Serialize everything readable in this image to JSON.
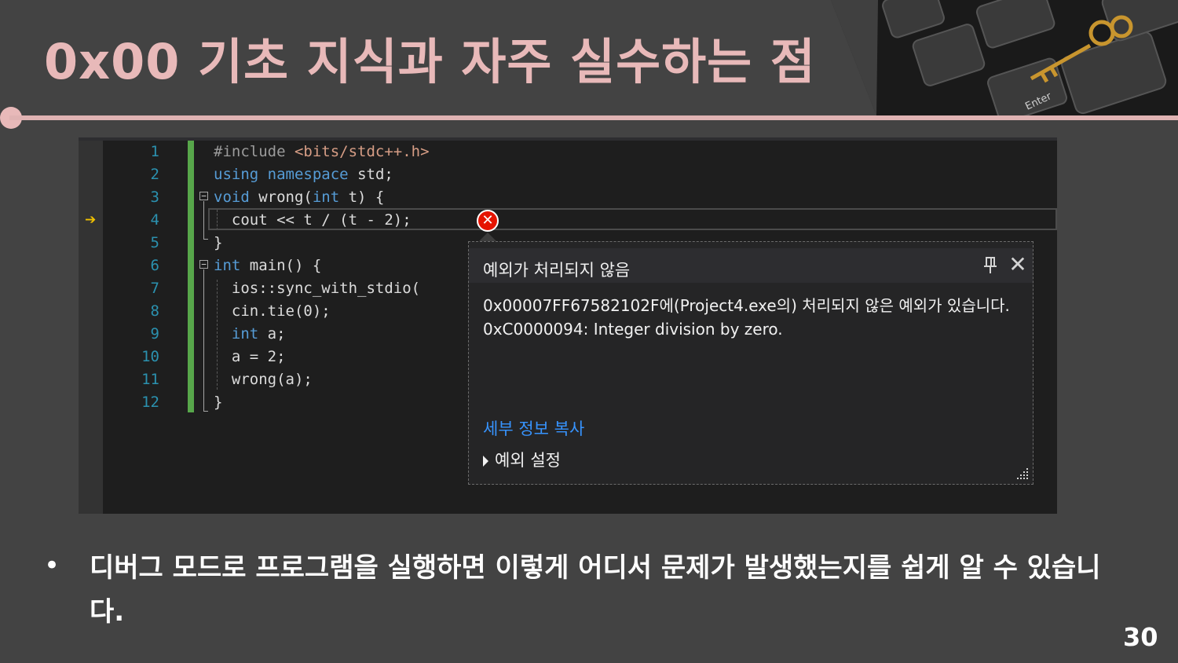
{
  "slide": {
    "title": "0x00  기초 지식과 자주 실수하는 점",
    "bullet": "디버그 모드로 프로그램을 실행하면 이렇게 어디서 문제가 발생했는지를 쉽게 알 수 있습니다.",
    "page_number": "30"
  },
  "editor": {
    "line_numbers": [
      "1",
      "2",
      "3",
      "4",
      "5",
      "6",
      "7",
      "8",
      "9",
      "10",
      "11",
      "12"
    ],
    "code": {
      "l1_pre": "#include",
      "l1_str": "<bits/stdc++.h>",
      "l2_kw1": "using",
      "l2_kw2": "namespace",
      "l2_rest": "std;",
      "l3_kw": "void",
      "l3_mid": " wrong(",
      "l3_kw2": "int",
      "l3_end": " t) {",
      "l4": "  cout << t / (t - 2);",
      "l5": "}",
      "l6_kw": "int",
      "l6_rest": " main() {",
      "l7": "  ios::sync_with_stdio(",
      "l8": "  cin.tie(0);",
      "l9_kw": "int",
      "l9_rest": " a;",
      "l10": "  a = 2;",
      "l11": "  wrong(a);",
      "l12": "}"
    }
  },
  "exception_popup": {
    "title": "예외가 처리되지 않음",
    "message": "0x00007FF67582102F에(Project4.exe의) 처리되지 않은 예외가 있습니다. 0xC0000094: Integer division by zero.",
    "copy_details": "세부 정보 복사",
    "exception_settings": "예외 설정"
  },
  "colors": {
    "title_pink": "#e8b9b9",
    "background": "#434343",
    "editor_bg": "#1e1e1e",
    "keyword_blue": "#569cd6",
    "link_blue": "#3794ff",
    "error_red": "#e51400"
  }
}
